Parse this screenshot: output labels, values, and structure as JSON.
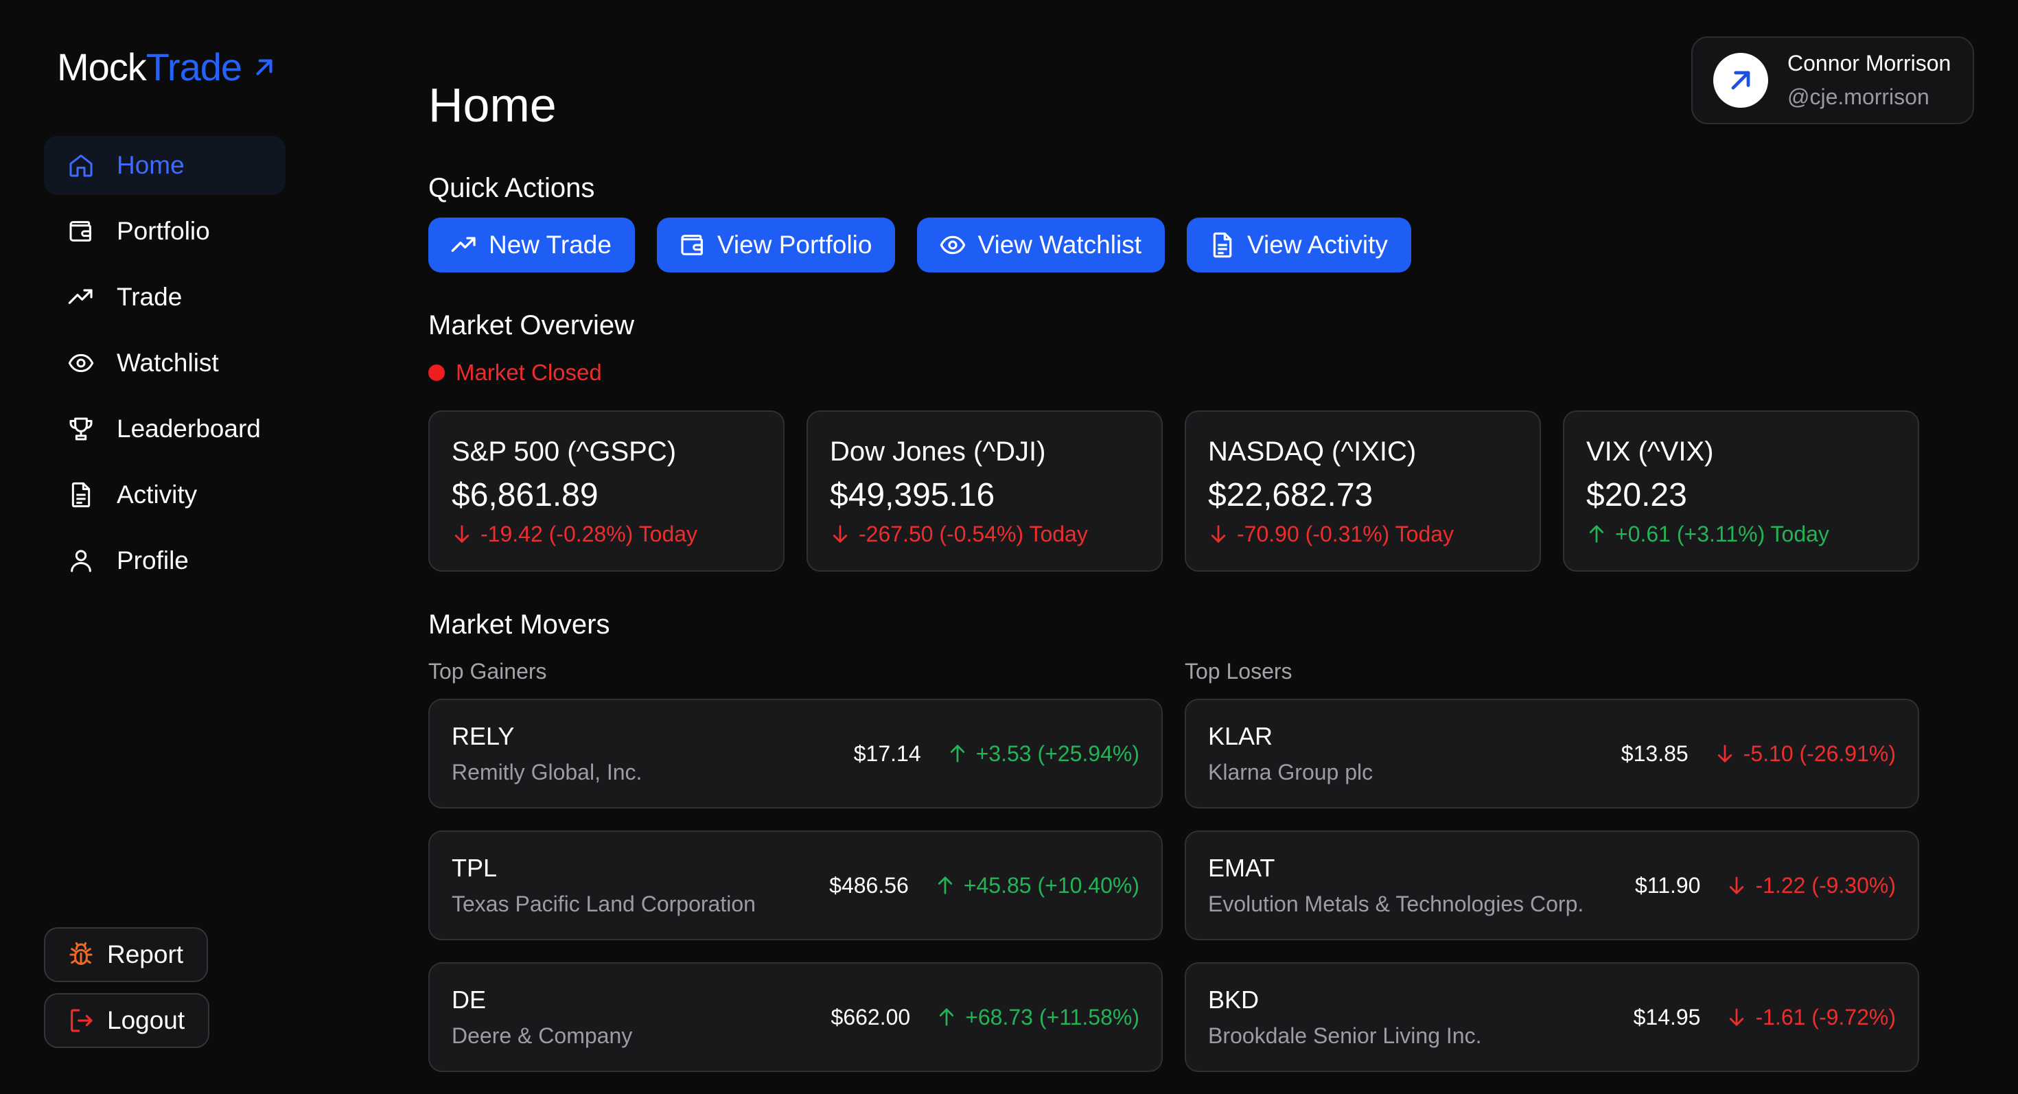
{
  "app": {
    "logo_part1": "Mock",
    "logo_part2": "Trade"
  },
  "colors": {
    "accent": "#1f5ef5",
    "background": "#0b0b0c",
    "card": "#19191b",
    "negative": "#ee2d2d",
    "positive": "#22b455"
  },
  "sidebar": {
    "items": [
      {
        "label": "Home",
        "icon": "home-icon",
        "active": true
      },
      {
        "label": "Portfolio",
        "icon": "wallet-icon"
      },
      {
        "label": "Trade",
        "icon": "trending-up-icon"
      },
      {
        "label": "Watchlist",
        "icon": "eye-icon"
      },
      {
        "label": "Leaderboard",
        "icon": "trophy-icon"
      },
      {
        "label": "Activity",
        "icon": "document-icon"
      },
      {
        "label": "Profile",
        "icon": "user-icon"
      }
    ],
    "report_label": "Report",
    "logout_label": "Logout"
  },
  "user": {
    "name": "Connor Morrison",
    "handle": "@cje.morrison"
  },
  "main": {
    "title": "Home",
    "quick_actions": {
      "title": "Quick Actions",
      "buttons": [
        {
          "label": "New Trade",
          "icon": "trending-up-icon"
        },
        {
          "label": "View Portfolio",
          "icon": "wallet-icon"
        },
        {
          "label": "View Watchlist",
          "icon": "eye-icon"
        },
        {
          "label": "View Activity",
          "icon": "document-icon"
        }
      ]
    },
    "market_overview": {
      "title": "Market Overview",
      "status": "Market Closed",
      "indices": [
        {
          "name": "S&P 500 (^GSPC)",
          "price": "$6,861.89",
          "change": "-19.42 (-0.28%) Today",
          "direction": "down"
        },
        {
          "name": "Dow Jones (^DJI)",
          "price": "$49,395.16",
          "change": "-267.50 (-0.54%) Today",
          "direction": "down"
        },
        {
          "name": "NASDAQ (^IXIC)",
          "price": "$22,682.73",
          "change": "-70.90 (-0.31%) Today",
          "direction": "down"
        },
        {
          "name": "VIX (^VIX)",
          "price": "$20.23",
          "change": "+0.61 (+3.11%) Today",
          "direction": "up"
        }
      ]
    },
    "market_movers": {
      "title": "Market Movers",
      "gainers_label": "Top Gainers",
      "losers_label": "Top Losers",
      "gainers": [
        {
          "symbol": "RELY",
          "company": "Remitly Global, Inc.",
          "price": "$17.14",
          "change": "+3.53 (+25.94%)"
        },
        {
          "symbol": "TPL",
          "company": "Texas Pacific Land Corporation",
          "price": "$486.56",
          "change": "+45.85 (+10.40%)"
        },
        {
          "symbol": "DE",
          "company": "Deere & Company",
          "price": "$662.00",
          "change": "+68.73 (+11.58%)"
        }
      ],
      "losers": [
        {
          "symbol": "KLAR",
          "company": "Klarna Group plc",
          "price": "$13.85",
          "change": "-5.10 (-26.91%)"
        },
        {
          "symbol": "EMAT",
          "company": "Evolution Metals & Technologies Corp.",
          "price": "$11.90",
          "change": "-1.22 (-9.30%)"
        },
        {
          "symbol": "BKD",
          "company": "Brookdale Senior Living Inc.",
          "price": "$14.95",
          "change": "-1.61 (-9.72%)"
        }
      ]
    }
  }
}
